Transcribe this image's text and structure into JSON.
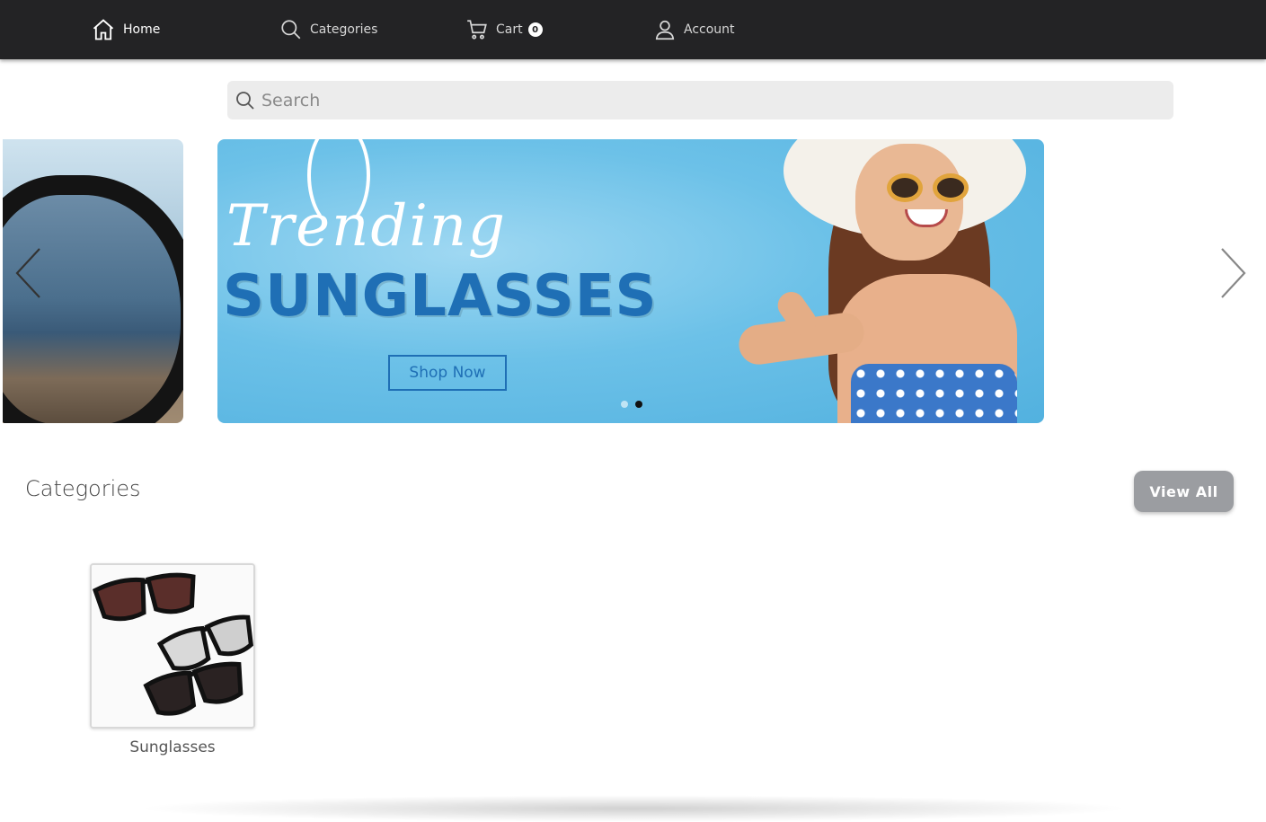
{
  "nav": {
    "items": [
      {
        "label": "Home",
        "icon": "home-icon"
      },
      {
        "label": "Categories",
        "icon": "search-icon"
      },
      {
        "label": "Cart",
        "icon": "cart-icon",
        "badge": "0"
      },
      {
        "label": "Account",
        "icon": "user-icon"
      }
    ]
  },
  "search": {
    "placeholder": "Search"
  },
  "banner": {
    "script_text": "Trending",
    "title": "SUNGLASSES",
    "button_label": "Shop Now",
    "colors": {
      "title": "#1f6fb5",
      "background": "#6cc1e8"
    }
  },
  "categories": {
    "title": "Categories",
    "view_all_label": "View All",
    "items": [
      {
        "label": "Sunglasses"
      }
    ]
  }
}
